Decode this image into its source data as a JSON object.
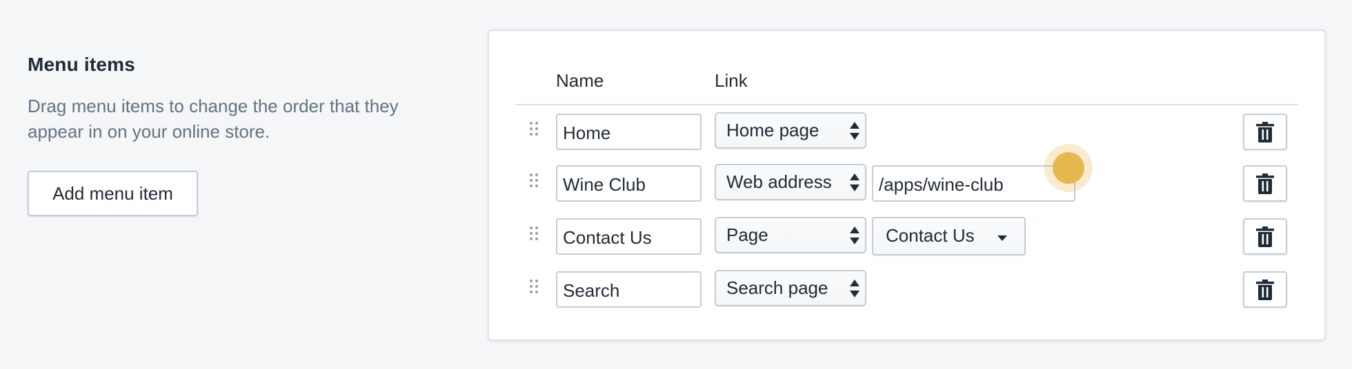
{
  "section": {
    "title": "Menu items",
    "description": "Drag menu items to change the order that they appear in on your online store.",
    "add_button_label": "Add menu item"
  },
  "table": {
    "headers": {
      "name": "Name",
      "link": "Link"
    },
    "rows": [
      {
        "name": "Home",
        "link_type": "Home page",
        "link_value": ""
      },
      {
        "name": "Wine Club",
        "link_type": "Web address",
        "link_value": "/apps/wine-club"
      },
      {
        "name": "Contact Us",
        "link_type": "Page",
        "link_value": "Contact Us"
      },
      {
        "name": "Search",
        "link_type": "Search page",
        "link_value": ""
      }
    ]
  },
  "icons": {
    "drag_handle": "drag-handle-icon",
    "delete": "trash-icon",
    "select_arrows": "select-arrows-icon",
    "dropdown_caret": "caret-down-icon"
  },
  "colors": {
    "background": "#f4f6f8",
    "card": "#ffffff",
    "border": "#c4cdd5",
    "text": "#212b36",
    "subdued_text": "#637381",
    "cursor_highlight": "#e5b850"
  }
}
